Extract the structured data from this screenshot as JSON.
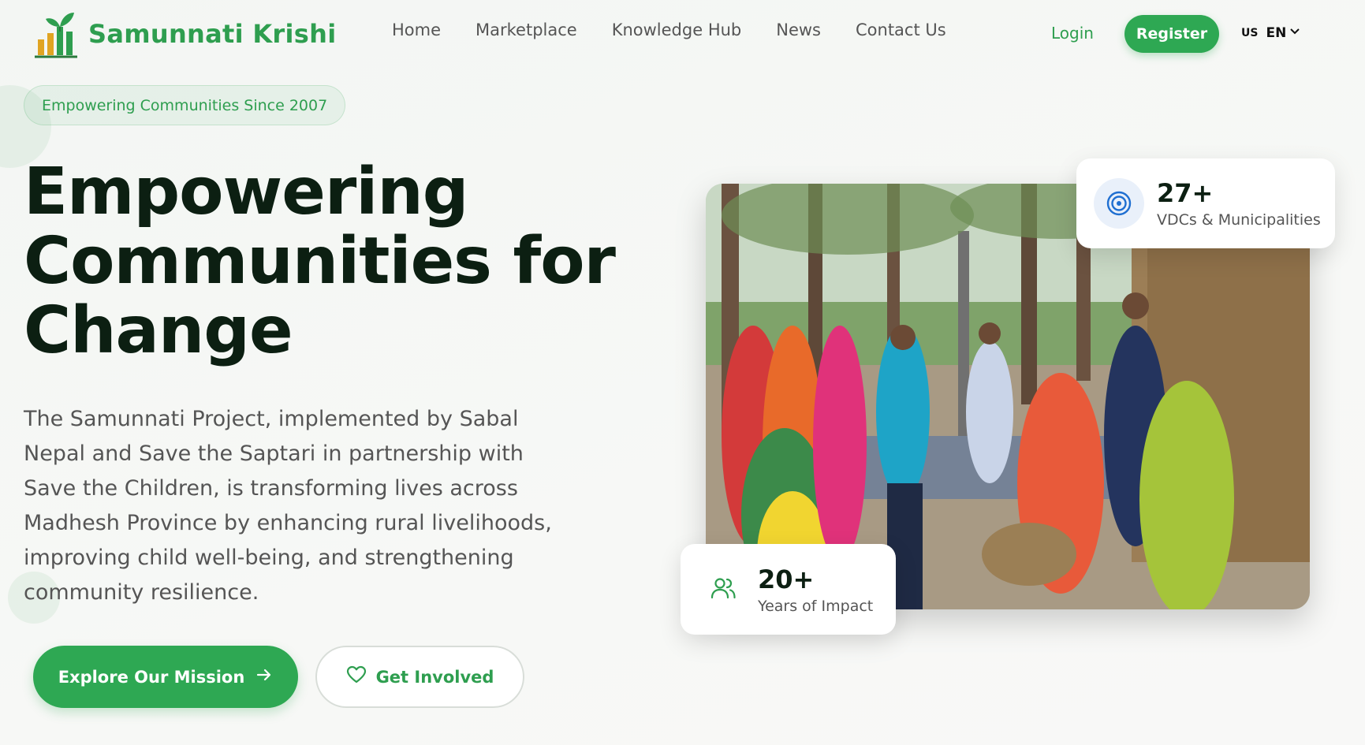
{
  "brand": {
    "name": "Samunnati Krishi",
    "logo_icon": "plant-growth-chart-icon",
    "color": "#2e9e4f"
  },
  "nav": {
    "items": [
      {
        "label": "Home"
      },
      {
        "label": "Marketplace"
      },
      {
        "label": "Knowledge Hub"
      },
      {
        "label": "News"
      },
      {
        "label": "Contact Us"
      }
    ],
    "login_label": "Login",
    "register_label": "Register",
    "language": {
      "flag": "US",
      "code": "EN",
      "icon": "chevron-down-icon"
    }
  },
  "hero": {
    "badge": "Empowering Communities Since 2007",
    "headline": "Empowering Communities for Change",
    "description": "The Samunnati Project, implemented by Sabal Nepal and Save the Saptari in partnership with Save the Children, is transforming lives across Madhesh Province by enhancing rural livelihoods, improving child well-being, and strengthening community resilience.",
    "primary_button": {
      "label": "Explore Our Mission",
      "icon": "arrow-right-icon"
    },
    "secondary_button": {
      "label": "Get Involved",
      "icon": "heart-icon"
    },
    "photo": {
      "subject": "community-gathering-photo"
    },
    "stats": [
      {
        "value": "27+",
        "label": "VDCs & Municipalities",
        "icon": "target-icon"
      },
      {
        "value": "20+",
        "label": "Years of Impact",
        "icon": "users-icon"
      }
    ]
  },
  "colors": {
    "accent": "#2ea853",
    "headline": "#0c1f12",
    "text": "#555555"
  }
}
